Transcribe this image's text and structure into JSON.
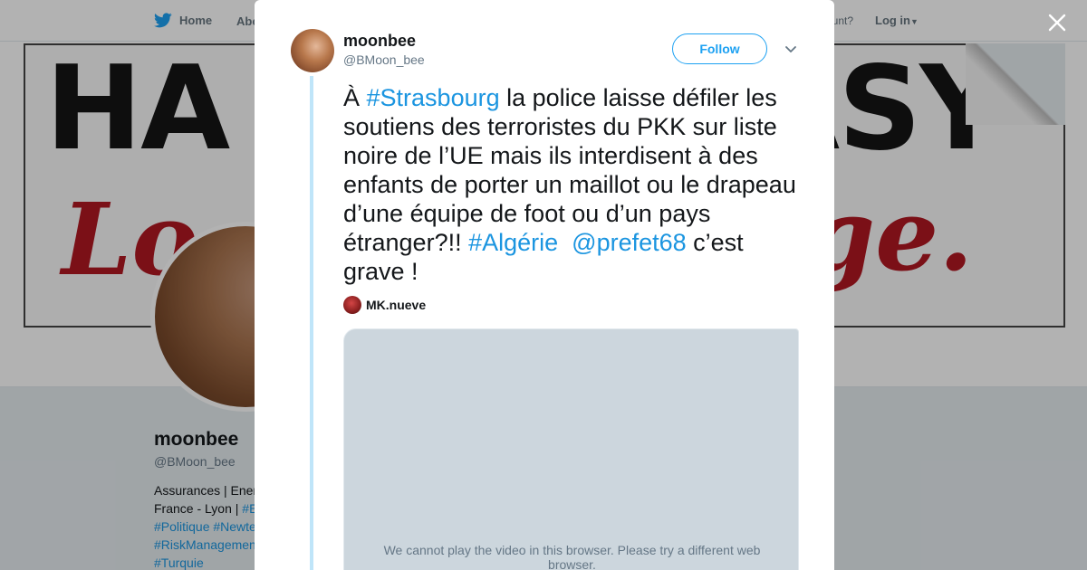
{
  "nav": {
    "home_label": "Home",
    "about_label": "Abo",
    "account_prompt": "ccount?",
    "login_label": "Log in"
  },
  "banner": {
    "line1_left": "HA",
    "line1_right": "ASY",
    "line2_left": "Lo",
    "line2_right": "age."
  },
  "profile": {
    "name": "moonbee",
    "handle": "@BMoon_bee",
    "bio_lines": [
      {
        "text": "Assurances | Ener"
      },
      {
        "text": "France - Lyon | ",
        "link": "#E"
      },
      {
        "link": "#Politique #Newte"
      },
      {
        "link": "#RiskManagement"
      },
      {
        "link": "#Turquie"
      }
    ]
  },
  "modal": {
    "close_icon": "close-icon",
    "author": {
      "name": "moonbee",
      "handle": "@BMoon_bee"
    },
    "follow_label": "Follow",
    "tweet": {
      "part1": "À ",
      "hashtag1": "#Strasbourg",
      "part2": " la police laisse défiler les soutiens des terroristes du PKK sur liste noire de l’UE mais ils interdisent à des enfants de porter un maillot ou le drapeau d’une équipe de foot ou d’un pays étranger?!! ",
      "hashtag2": "#Algérie",
      "spacer": "  ",
      "mention": "@prefet68",
      "part3": " c’est grave !"
    },
    "media": {
      "author_name": "MK.nueve",
      "video_message": "We cannot play the video in this browser. Please try a different web browser."
    }
  },
  "colors": {
    "link": "#1b95e0",
    "twitter_blue": "#1da1f2",
    "thread_line": "#bfe5f9",
    "video_bg": "#ccd6dd"
  }
}
